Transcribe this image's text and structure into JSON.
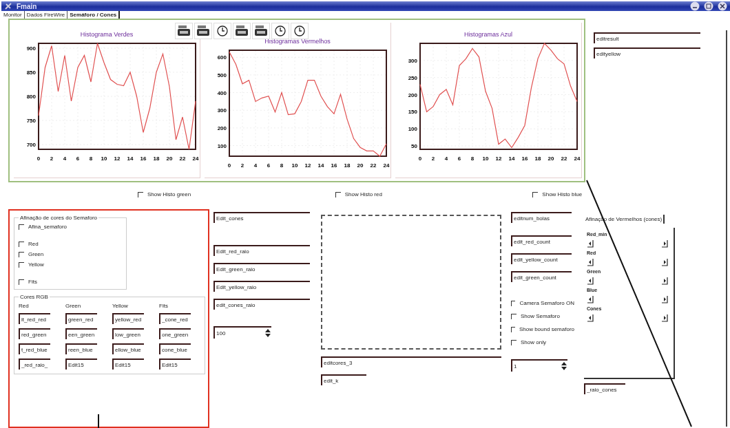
{
  "window": {
    "title": "Fmain",
    "controls": [
      {
        "kind": "minimize"
      },
      {
        "kind": "maximize"
      },
      {
        "kind": "close"
      }
    ]
  },
  "tabs": [
    {
      "label": "Monitor",
      "selected": false
    },
    {
      "label": "Dados FireWire",
      "selected": false
    },
    {
      "label": "Semáforo / Cones",
      "selected": true
    }
  ],
  "toolbar": [
    {
      "kind": "device"
    },
    {
      "kind": "device"
    },
    {
      "kind": "clock"
    },
    {
      "kind": "device"
    },
    {
      "kind": "device"
    },
    {
      "kind": "clock"
    },
    {
      "kind": "clock"
    }
  ],
  "charts": [
    {
      "chart_data": {
        "type": "line",
        "title": "Histograma Verdes",
        "x": [
          0,
          1,
          2,
          3,
          4,
          5,
          6,
          7,
          8,
          9,
          10,
          11,
          12,
          13,
          14,
          15,
          16,
          17,
          18,
          19,
          20,
          21,
          22,
          23,
          24
        ],
        "xlim": [
          0,
          24
        ],
        "ylim": [
          690,
          910
        ],
        "xticks": [
          0,
          2,
          4,
          6,
          8,
          10,
          12,
          14,
          16,
          18,
          20,
          22,
          24
        ],
        "yticks": [
          700,
          750,
          800,
          850,
          900
        ],
        "grid": true,
        "series": [
          {
            "color": "#e05050",
            "values": [
              760,
              860,
              905,
              810,
              885,
              790,
              860,
              885,
              830,
              910,
              870,
              835,
              825,
              822,
              850,
              800,
              725,
              775,
              850,
              888,
              820,
              710,
              757,
              690,
              790
            ]
          }
        ]
      }
    },
    {
      "chart_data": {
        "type": "line",
        "title": "Histogramas Vermelhos",
        "x": [
          0,
          1,
          2,
          3,
          4,
          5,
          6,
          7,
          8,
          9,
          10,
          11,
          12,
          13,
          14,
          15,
          16,
          17,
          18,
          19,
          20,
          21,
          22,
          23,
          24
        ],
        "xlim": [
          0,
          24
        ],
        "ylim": [
          40,
          640
        ],
        "xticks": [
          0,
          2,
          4,
          6,
          8,
          10,
          12,
          14,
          16,
          18,
          20,
          22,
          24
        ],
        "yticks": [
          100,
          200,
          300,
          400,
          500,
          600
        ],
        "grid": true,
        "series": [
          {
            "color": "#e05050",
            "values": [
              630,
              560,
              450,
              470,
              350,
              370,
              380,
              290,
              400,
              275,
              280,
              350,
              470,
              470,
              380,
              320,
              280,
              390,
              250,
              140,
              90,
              70,
              70,
              40,
              110
            ]
          }
        ]
      }
    },
    {
      "chart_data": {
        "type": "line",
        "title": "Histogramas Azul",
        "x": [
          0,
          1,
          2,
          3,
          4,
          5,
          6,
          7,
          8,
          9,
          10,
          11,
          12,
          13,
          14,
          15,
          16,
          17,
          18,
          19,
          20,
          21,
          22,
          23,
          24
        ],
        "xlim": [
          0,
          24
        ],
        "ylim": [
          40,
          350
        ],
        "xticks": [
          0,
          2,
          4,
          6,
          8,
          10,
          12,
          14,
          16,
          18,
          20,
          22,
          24
        ],
        "yticks": [
          50,
          100,
          150,
          200,
          250,
          300
        ],
        "grid": true,
        "series": [
          {
            "color": "#e05050",
            "values": [
              230,
              150,
              165,
              200,
              215,
              170,
              285,
              305,
              335,
              310,
              210,
              160,
              55,
              70,
              45,
              75,
              110,
              220,
              305,
              350,
              330,
              305,
              290,
              225,
              180
            ]
          }
        ]
      }
    }
  ],
  "top_fields": [
    "editresult",
    "edityellow"
  ],
  "histo_checks": [
    {
      "label": "Show Histo green",
      "checked": false
    },
    {
      "label": "Show Histo red",
      "checked": false
    },
    {
      "label": "Show Histo blue",
      "checked": false
    }
  ],
  "tuning_group": {
    "title": "Afinação de cores do Semaforo",
    "checks": [
      {
        "label": "Afina_semaforo",
        "checked": false
      },
      {
        "label": "Red",
        "checked": false
      },
      {
        "label": "Green",
        "checked": false
      },
      {
        "label": "Yellow",
        "checked": false
      },
      {
        "label": "Fits",
        "checked": false
      }
    ]
  },
  "rgb_group": {
    "title": "Cores RGB",
    "columns": [
      "Red",
      "Green",
      "Yellow",
      "Fits"
    ],
    "rows": [
      [
        "it_red_red",
        "green_red",
        "yellow_red",
        "_cone_red"
      ],
      [
        "red_green",
        "een_green",
        "low_green",
        "one_green"
      ],
      [
        "t_red_blue",
        "reen_blue",
        "ellow_blue",
        "cone_blue"
      ],
      [
        "_red_raio_",
        "Edit15",
        "Edit15",
        "Edit15"
      ]
    ]
  },
  "raio_fields": [
    "Edit_cones",
    "Edit_red_raio",
    "Edit_green_raio",
    "Edit_yellow_raio",
    "edit_cones_raio"
  ],
  "raio_spin": "100",
  "preview_fields": [
    "editcores_3",
    "edit_k"
  ],
  "count_fields": [
    "editnum_bolas",
    "edit_red_count",
    "edit_yellow_count",
    "edit_green_count"
  ],
  "camera_checks": [
    {
      "label": "Camera Semaforo ON",
      "checked": false
    },
    {
      "label": "Show Semaforo",
      "checked": false
    },
    {
      "label": "Show bound semaforo",
      "checked": false
    },
    {
      "label": "Show only",
      "checked": false
    }
  ],
  "count_spin": "1",
  "red_tuning": {
    "tab": {
      "label": "Afinação de Vermelhos (cones)",
      "selected": true
    },
    "sliders": [
      "Red_min",
      "Red",
      "Green",
      "Blue",
      "Cones"
    ],
    "field": "_raio_cones"
  }
}
